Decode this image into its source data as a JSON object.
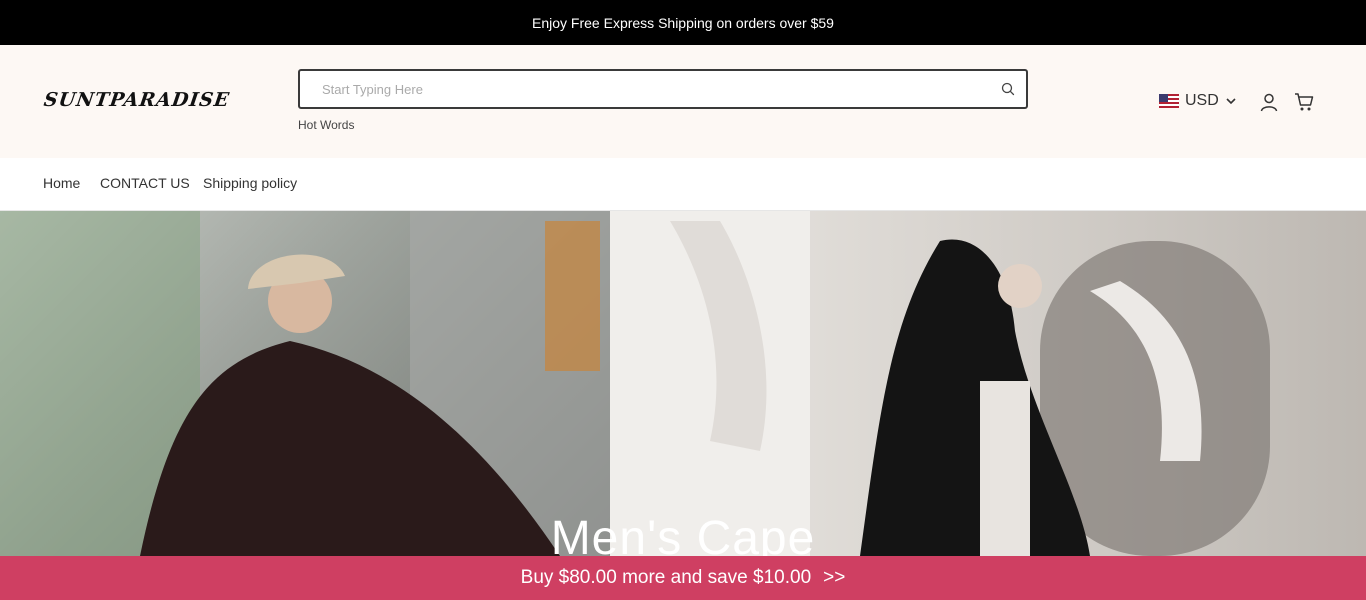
{
  "announcement": "Enjoy Free Express Shipping on orders over $59",
  "brand": {
    "logo_text": "SUNTPARADISE"
  },
  "search": {
    "placeholder": "Start Typing Here",
    "value": "",
    "hot_words_label": "Hot Words"
  },
  "currency": {
    "code": "USD",
    "flag_icon": "us-flag-icon"
  },
  "icons": {
    "search": "search-icon",
    "user": "user-icon",
    "cart": "cart-icon",
    "dropdown": "chevron-down-icon"
  },
  "nav": {
    "items": [
      {
        "label": "Home"
      },
      {
        "label": "CONTACT US"
      },
      {
        "label": "Shipping policy"
      }
    ]
  },
  "hero": {
    "title": "Men's Cape"
  },
  "promo": {
    "text": "Buy $80.00 more and save $10.00",
    "arrow": ">>"
  },
  "colors": {
    "announcement_bg": "#000000",
    "header_bg": "#fdf8f4",
    "promo_bg": "#cf3f62"
  }
}
